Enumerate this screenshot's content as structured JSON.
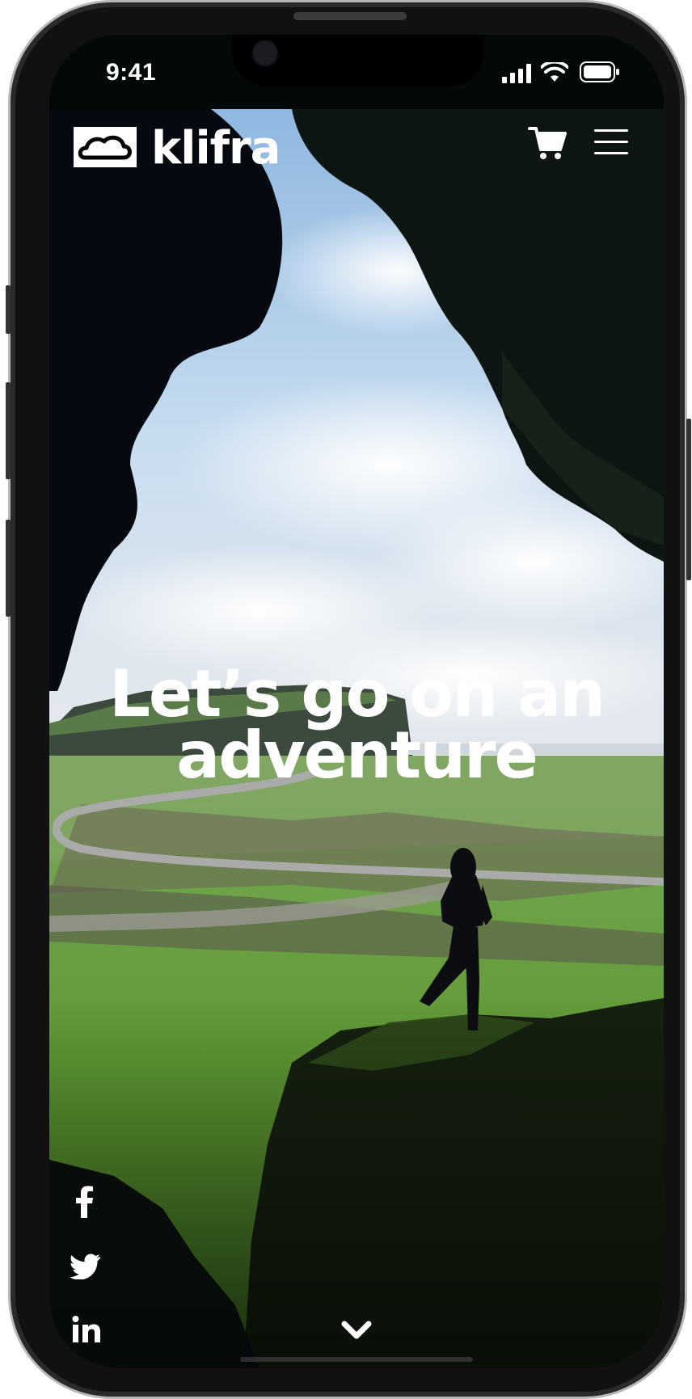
{
  "status_bar": {
    "time": "9:41",
    "icons": [
      "cellular-signal-icon",
      "wifi-icon",
      "battery-icon"
    ]
  },
  "header": {
    "brand_name": "klifra",
    "logo_icon": "cloud-logo-icon",
    "cart_icon": "shopping-cart-icon",
    "menu_icon": "hamburger-menu-icon"
  },
  "hero": {
    "headline": "Let’s go on an adventure",
    "scroll_icon": "chevron-down-icon"
  },
  "social_links": [
    {
      "name": "facebook",
      "icon": "facebook-icon",
      "label": "f"
    },
    {
      "name": "twitter",
      "icon": "twitter-icon"
    },
    {
      "name": "linkedin",
      "icon": "linkedin-icon",
      "label": "in"
    }
  ],
  "colors": {
    "text": "#ffffff",
    "status_bar_bg": "#030808",
    "grass": "#5e9a35",
    "sky": "#b9d3ea"
  }
}
